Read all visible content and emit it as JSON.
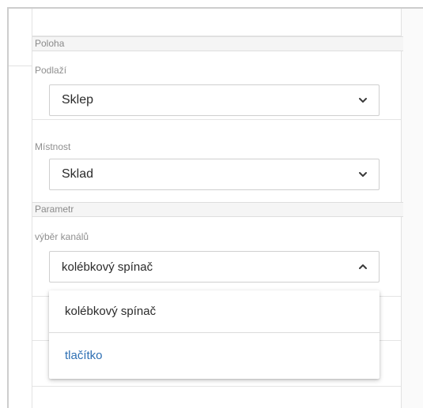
{
  "sections": {
    "location": {
      "header": "Poloha",
      "floor": {
        "label": "Podlaží",
        "value": "Sklep"
      },
      "room": {
        "label": "Místnost",
        "value": "Sklad"
      }
    },
    "parameter": {
      "header": "Parametr",
      "channel": {
        "label": "výběr kanálů",
        "value": "kolébkový spínač",
        "options": [
          "kolébkový spínač",
          "tlačítko"
        ]
      }
    }
  },
  "colors": {
    "selected_option_text": "#2d6fb3",
    "header_bg": "#f5f5f5",
    "border": "#cfcfcf"
  },
  "icons": {
    "floor_select": "chevron-down-icon",
    "room_select": "chevron-down-icon",
    "channel_select": "chevron-up-icon"
  }
}
